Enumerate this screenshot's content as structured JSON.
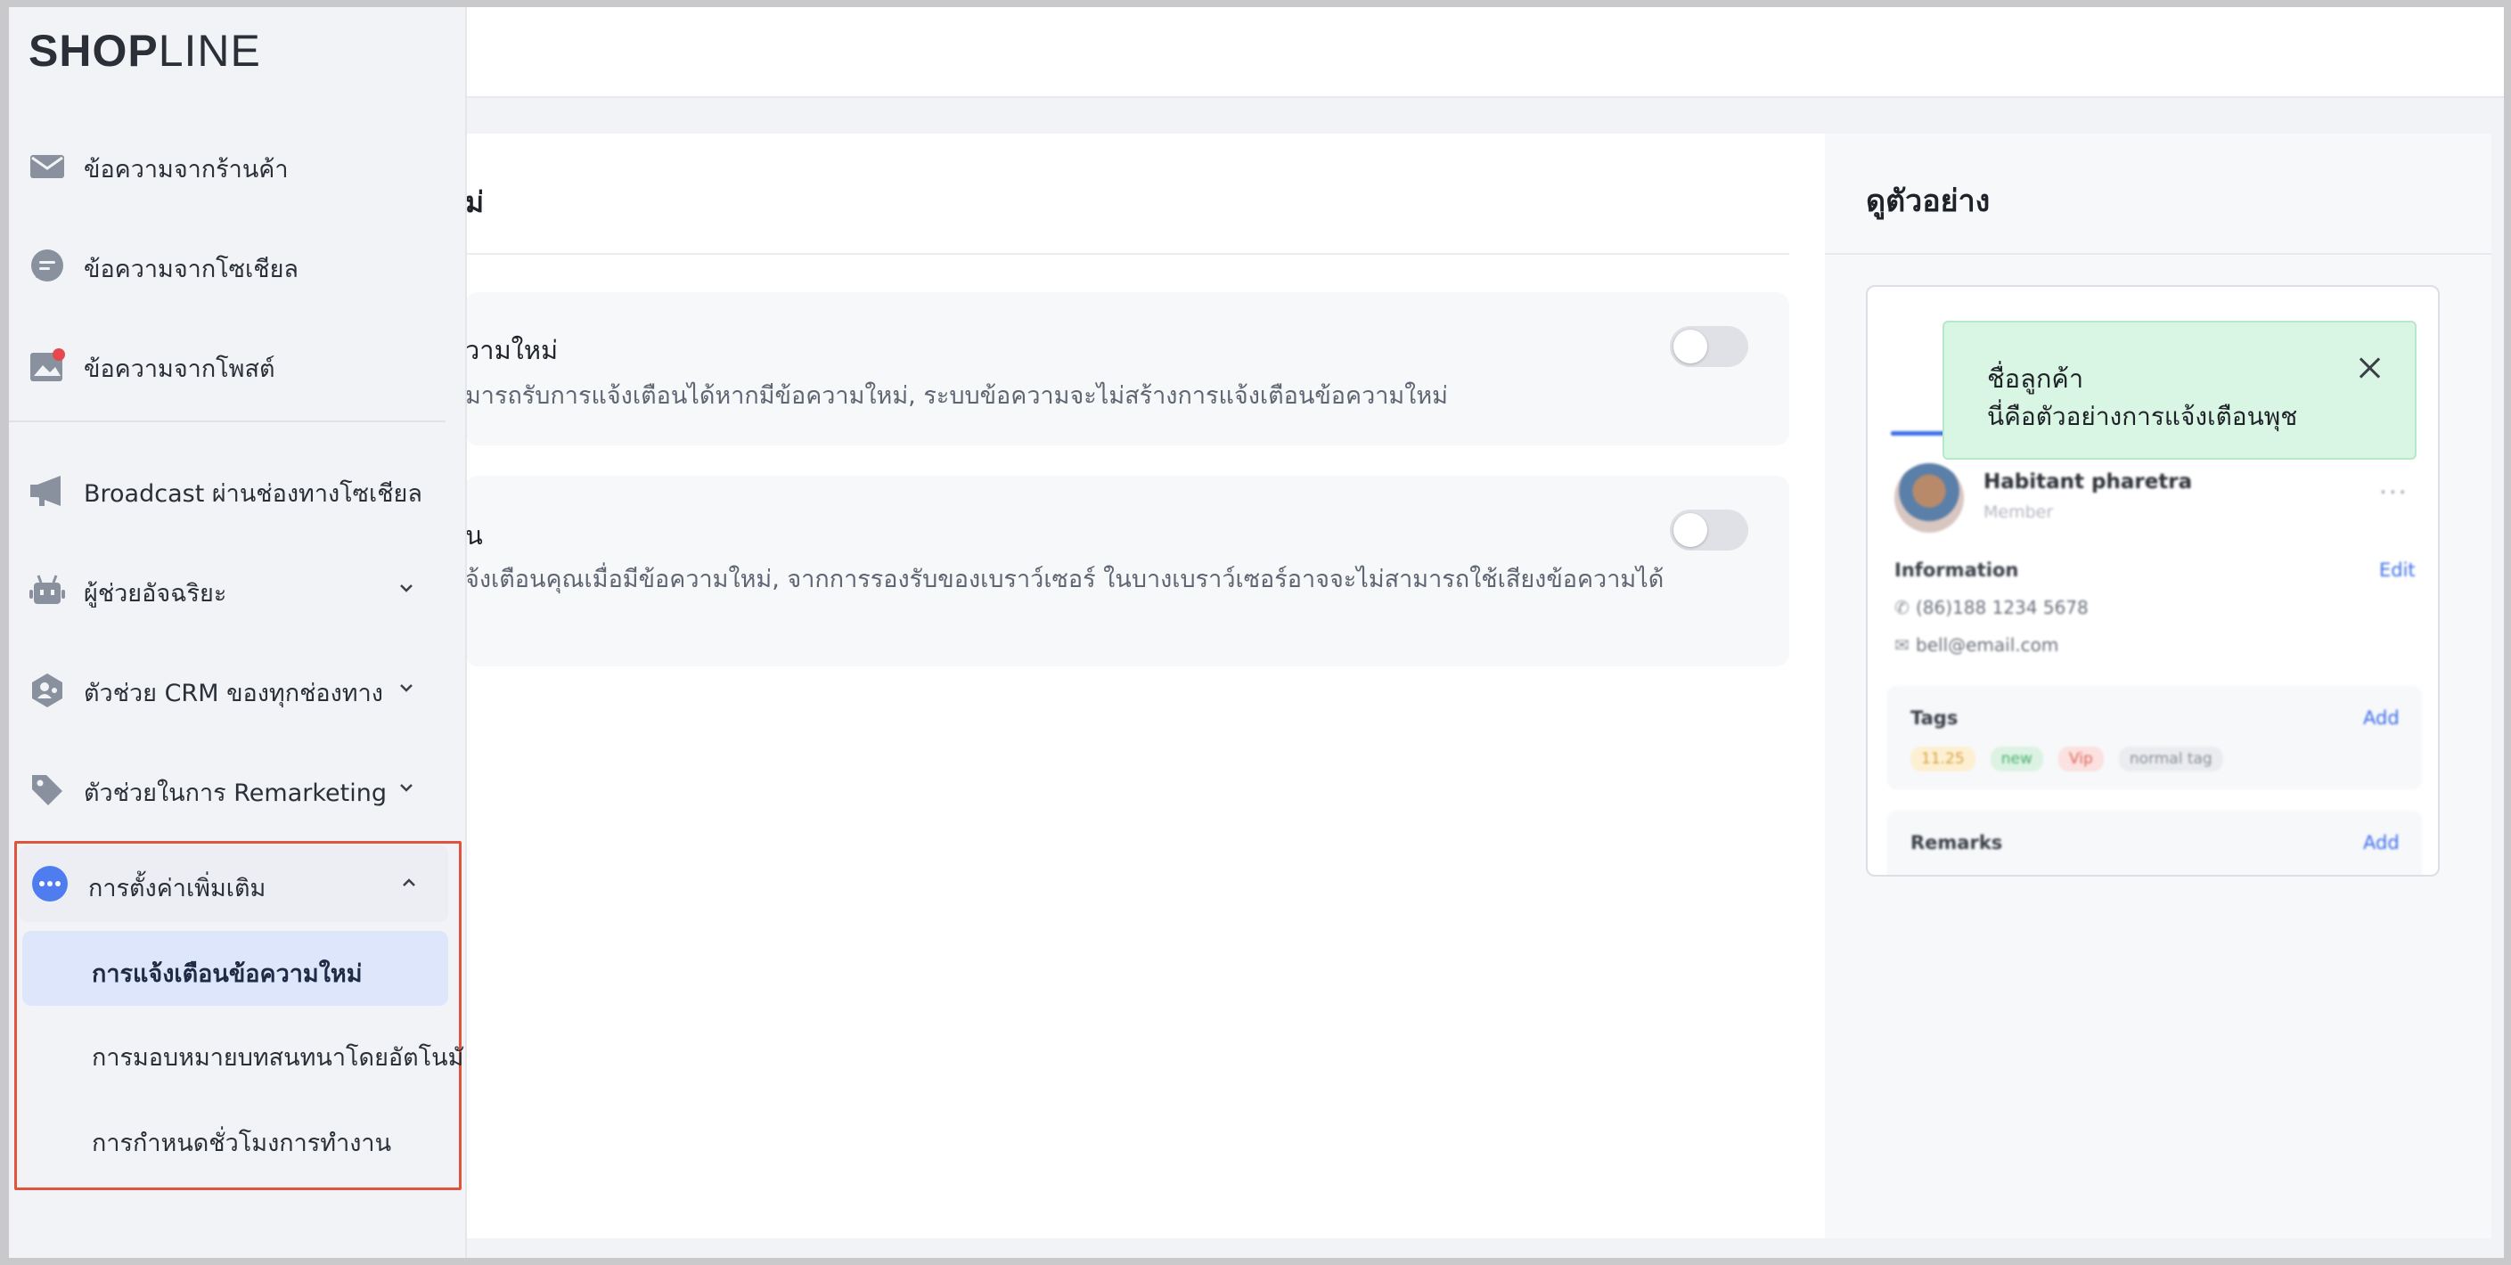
{
  "app": {
    "logo_bold": "SHOP",
    "logo_rest": "LINE"
  },
  "sidebar": {
    "items": [
      {
        "label": "ข้อความจากร้านค้า",
        "icon": "envelope-icon"
      },
      {
        "label": "ข้อความจากโซเชียล",
        "icon": "chat-bubble-icon"
      },
      {
        "label": "ข้อความจากโพสต์",
        "icon": "image-post-icon",
        "badge_color": "#e5484d"
      },
      {
        "label": "Broadcast ผ่านช่องทางโซเชียล",
        "icon": "megaphone-icon"
      },
      {
        "label": "ผู้ช่วยอัจฉริยะ",
        "icon": "robot-icon"
      },
      {
        "label": "ตัวช่วย CRM ของทุกช่องทาง",
        "icon": "crm-shield-icon"
      },
      {
        "label": "ตัวช่วยในการ Remarketing",
        "icon": "tags-icon"
      }
    ],
    "group": {
      "label": "การตั้งค่าเพิ่มเติม",
      "icon": "more-dots-icon",
      "sub_items": [
        {
          "label": "การแจ้งเตือนข้อความใหม่",
          "active": true
        },
        {
          "label": "การมอบหมายบทสนทนาโดยอัตโนมัติ",
          "active": false
        },
        {
          "label": "การกำหนดชั่วโมงการทำงาน",
          "active": false
        }
      ]
    }
  },
  "settings": {
    "title_visible": "ม่",
    "rows": [
      {
        "title_visible": "วามใหม่",
        "desc_visible": "มารถรับการแจ้งเตือนได้หากมีข้อความใหม่, ระบบข้อความจะไม่สร้างการแจ้งเตือนข้อความใหม่",
        "enabled": false
      },
      {
        "title_visible": "น",
        "desc_visible": "จ้งเตือนคุณเมื่อมีข้อความใหม่, จากการรองรับของเบราว์เซอร์ ในบางเบราว์เซอร์อาจจะไม่สามารถใช้เสียงข้อความได้",
        "enabled": false
      }
    ]
  },
  "preview": {
    "title": "ดูตัวอย่าง",
    "toast": {
      "title": "ชื่อลูกค้า",
      "body": "นี่คือตัวอย่างการแจ้งเตือนพุช"
    },
    "customer": {
      "name": "Habitant pharetra",
      "role": "Member",
      "more": "···",
      "information_label": "Information",
      "edit_label": "Edit",
      "phone": "(86)188 1234 5678",
      "email": "bell@email.com",
      "tags_label": "Tags",
      "add_label": "Add",
      "tags": [
        "11.25",
        "new",
        "Vip",
        "normal tag"
      ],
      "remarks_label": "Remarks"
    }
  },
  "colors": {
    "accent": "#3c6fe8",
    "highlight_border": "#e0533d",
    "toast_bg": "#d9f5e3",
    "active_bg": "#dde6fb"
  }
}
